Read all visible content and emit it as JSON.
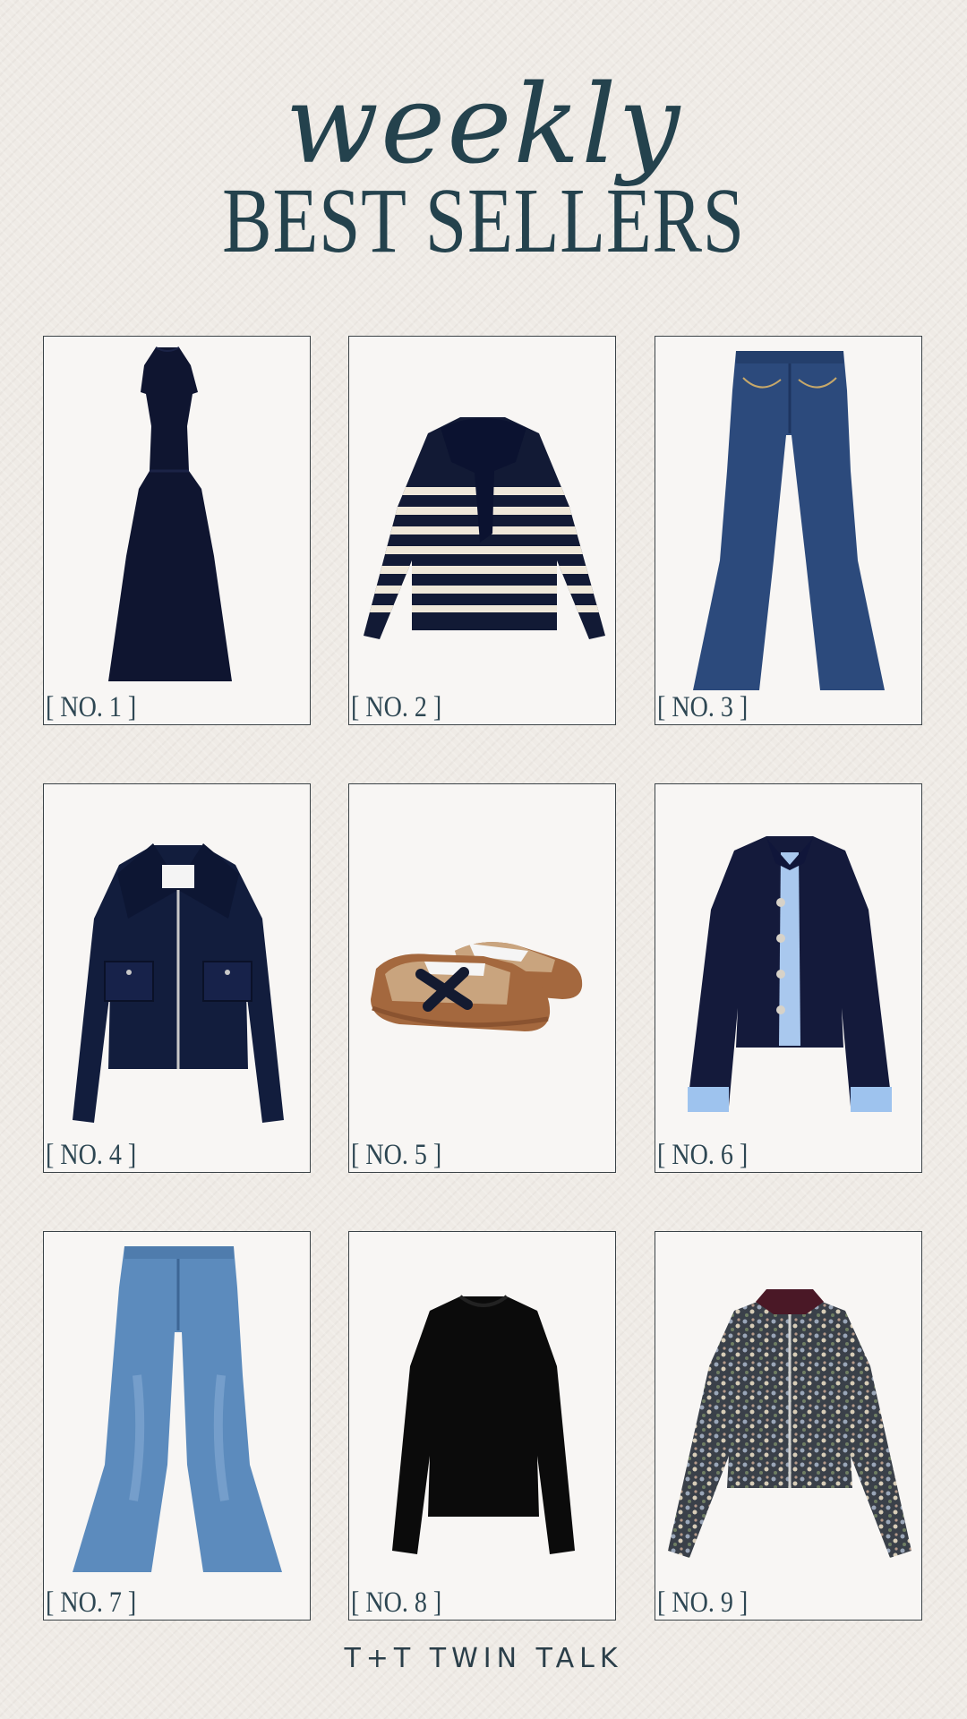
{
  "header": {
    "script_title": "weekly",
    "title": "BEST SELLERS"
  },
  "products": [
    {
      "label": "[ NO. 1 ]",
      "item": "navy dress-icon",
      "color": "#0f1530"
    },
    {
      "label": "[ NO. 2 ]",
      "item": "striped sweater-icon",
      "color": "#121a35"
    },
    {
      "label": "[ NO. 3 ]",
      "item": "flare jeans-icon",
      "color": "#2c4a7c"
    },
    {
      "label": "[ NO. 4 ]",
      "item": "navy jacket-icon",
      "color": "#121d3d"
    },
    {
      "label": "[ NO. 5 ]",
      "item": "sneakers-icon",
      "color": "#a4683e"
    },
    {
      "label": "[ NO. 6 ]",
      "item": "navy cardigan-icon",
      "color": "#141a3b"
    },
    {
      "label": "[ NO. 7 ]",
      "item": "light jeans-icon",
      "color": "#5c8bbd"
    },
    {
      "label": "[ NO. 8 ]",
      "item": "black sweater-icon",
      "color": "#0b0b0b"
    },
    {
      "label": "[ NO. 9 ]",
      "item": "floral jacket-icon",
      "color": "#545a63"
    }
  ],
  "footer": {
    "brand": "T+T TWIN TALK"
  }
}
